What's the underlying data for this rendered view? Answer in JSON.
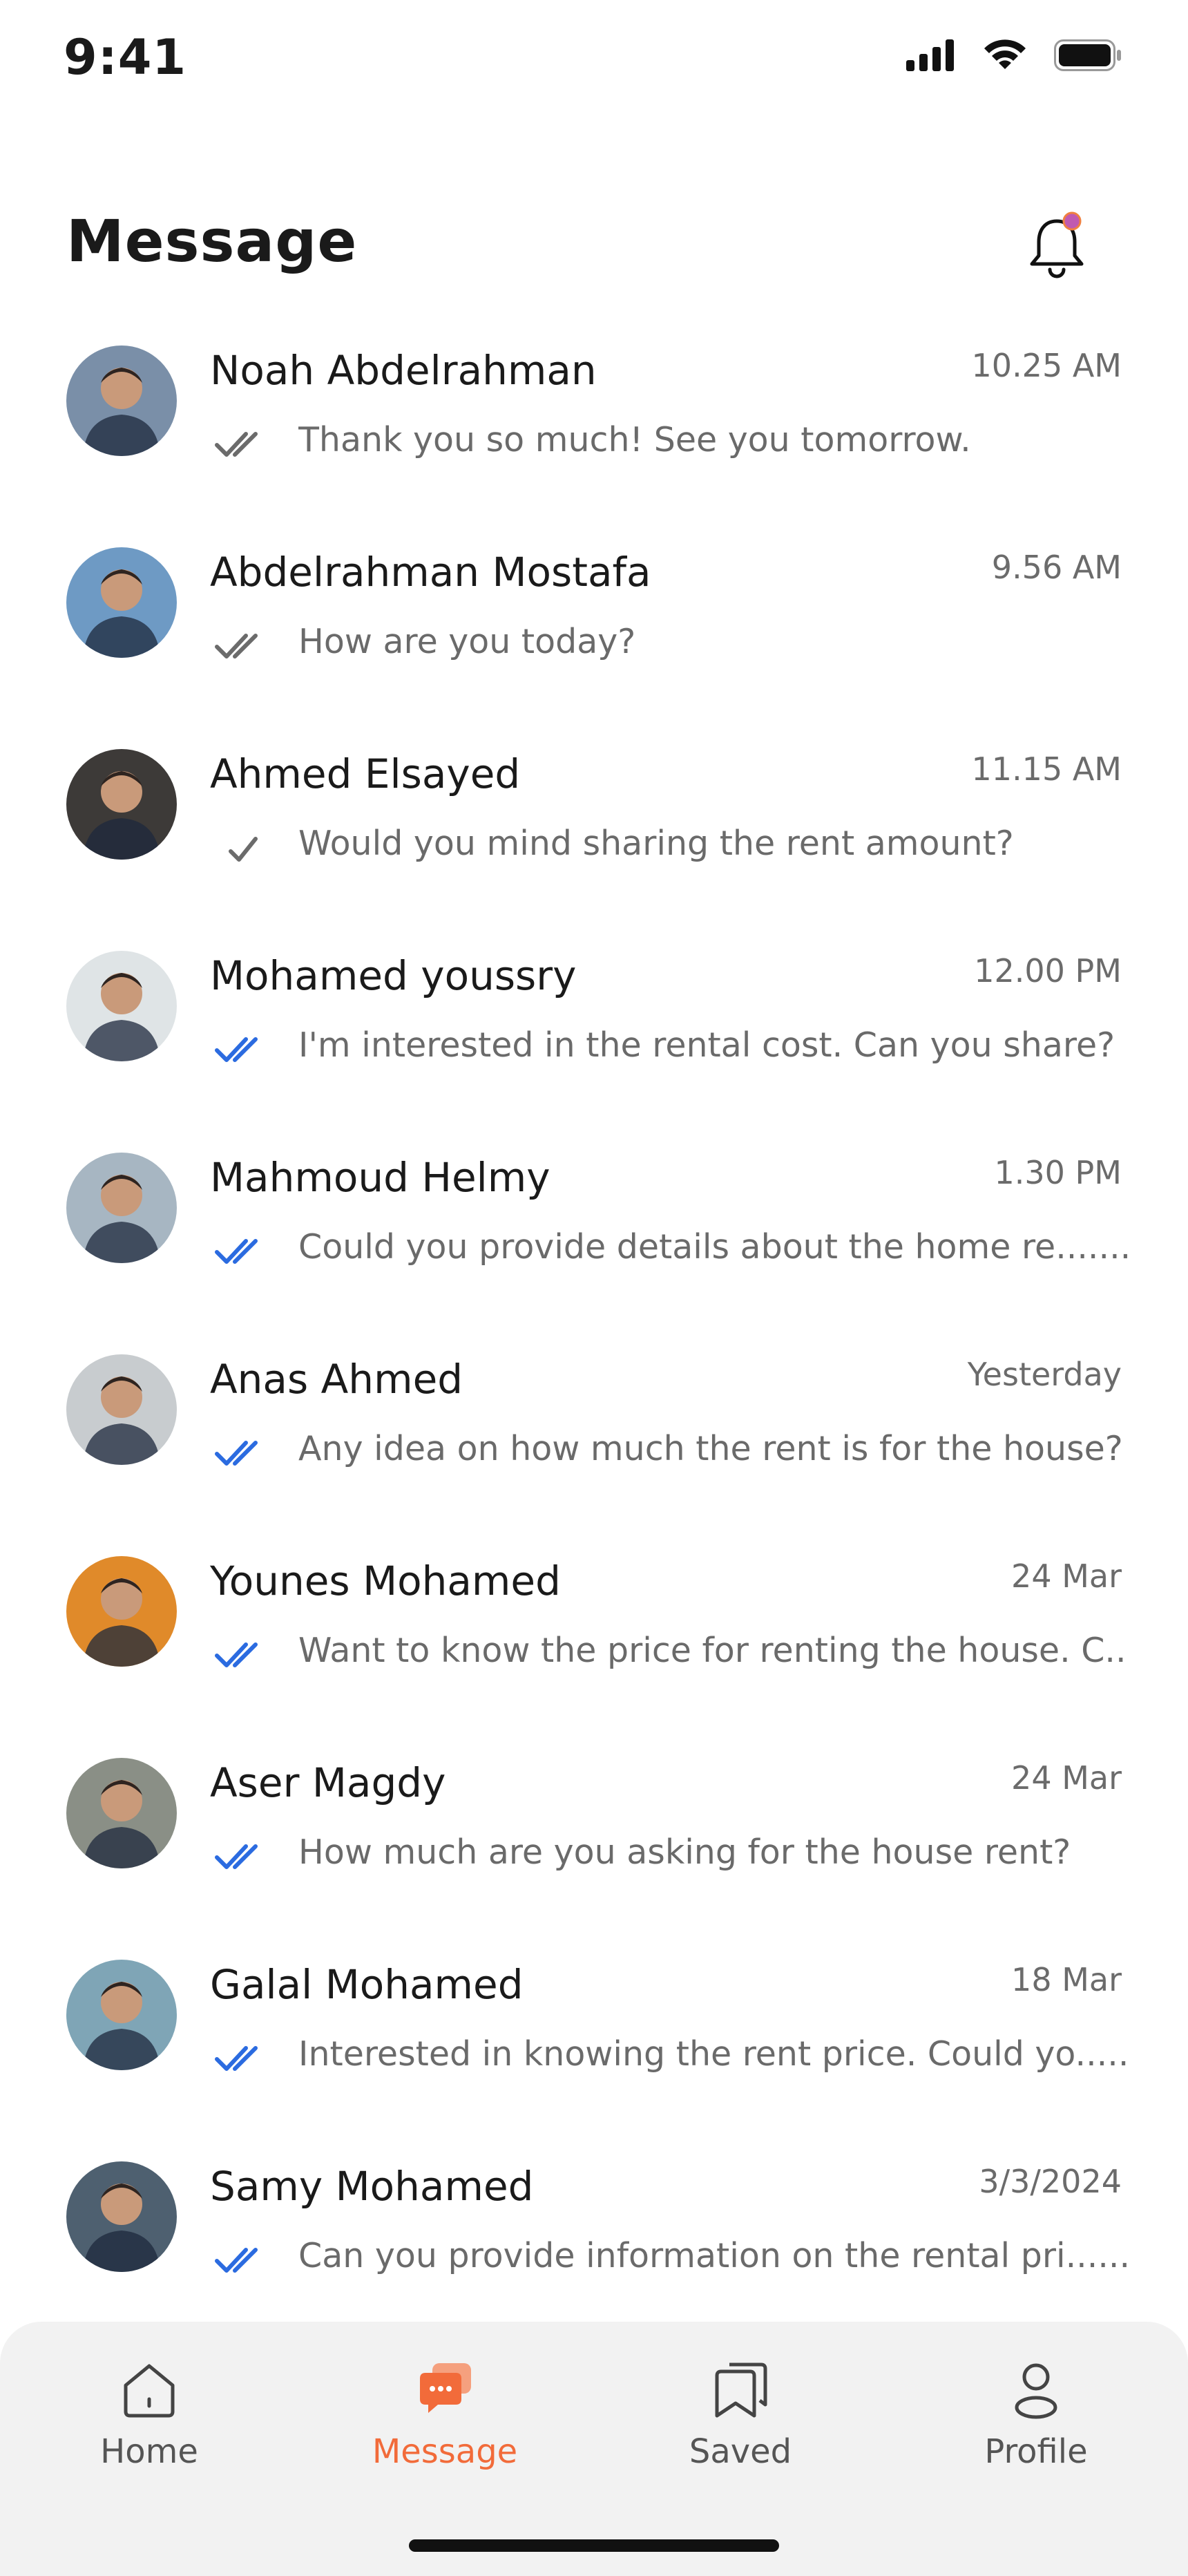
{
  "status_bar": {
    "time": "9:41"
  },
  "header": {
    "title": "Message"
  },
  "conversations": [
    {
      "name": "Noah Abdelrahman",
      "time": "10.25 AM",
      "preview": "Thank you so much! See you tomorrow.",
      "status": "delivered",
      "avatar_color": "#7a8fa8"
    },
    {
      "name": "Abdelrahman Mostafa",
      "time": "9.56 AM",
      "preview": "How are you today?",
      "status": "delivered",
      "avatar_color": "#6e9ac4"
    },
    {
      "name": "Ahmed Elsayed",
      "time": "11.15 AM",
      "preview": "Would you mind sharing the rent amount?",
      "status": "sent",
      "avatar_color": "#3d3a38"
    },
    {
      "name": "Mohamed youssry",
      "time": "12.00 PM",
      "preview": "I'm interested in the rental cost. Can you share?",
      "status": "read",
      "avatar_color": "#dfe4e6"
    },
    {
      "name": "Mahmoud Helmy",
      "time": "1.30 PM",
      "preview": "Could you provide details about the home re.......",
      "status": "read",
      "avatar_color": "#a7b6c2"
    },
    {
      "name": "Anas Ahmed",
      "time": "Yesterday",
      "preview": "Any idea on how much the rent is for the house?",
      "status": "read",
      "avatar_color": "#c8cccf"
    },
    {
      "name": "Younes Mohamed",
      "time": "24 Mar",
      "preview": "Want to know the price for renting the house. C.......",
      "status": "read",
      "avatar_color": "#e08a2a"
    },
    {
      "name": "Aser Magdy",
      "time": "24 Mar",
      "preview": "How much are you asking for the house rent?",
      "status": "read",
      "avatar_color": "#8a8f86"
    },
    {
      "name": "Galal Mohamed",
      "time": "18 Mar",
      "preview": "Interested in knowing the rent price. Could yo.......",
      "status": "read",
      "avatar_color": "#7fa5b6"
    },
    {
      "name": "Samy Mohamed",
      "time": "3/3/2024",
      "preview": "Can you provide information on the rental pri.......",
      "status": "read",
      "avatar_color": "#4e6070"
    }
  ],
  "tabs": [
    {
      "label": "Home",
      "icon": "home-icon",
      "active": false
    },
    {
      "label": "Message",
      "icon": "message-icon",
      "active": true
    },
    {
      "label": "Saved",
      "icon": "saved-icon",
      "active": false
    },
    {
      "label": "Profile",
      "icon": "profile-icon",
      "active": false
    }
  ],
  "colors": {
    "accent": "#f26b3a",
    "read_check": "#2b6be0",
    "check_gray": "#6b6b6b",
    "notification_dot": "#c05ab0"
  }
}
